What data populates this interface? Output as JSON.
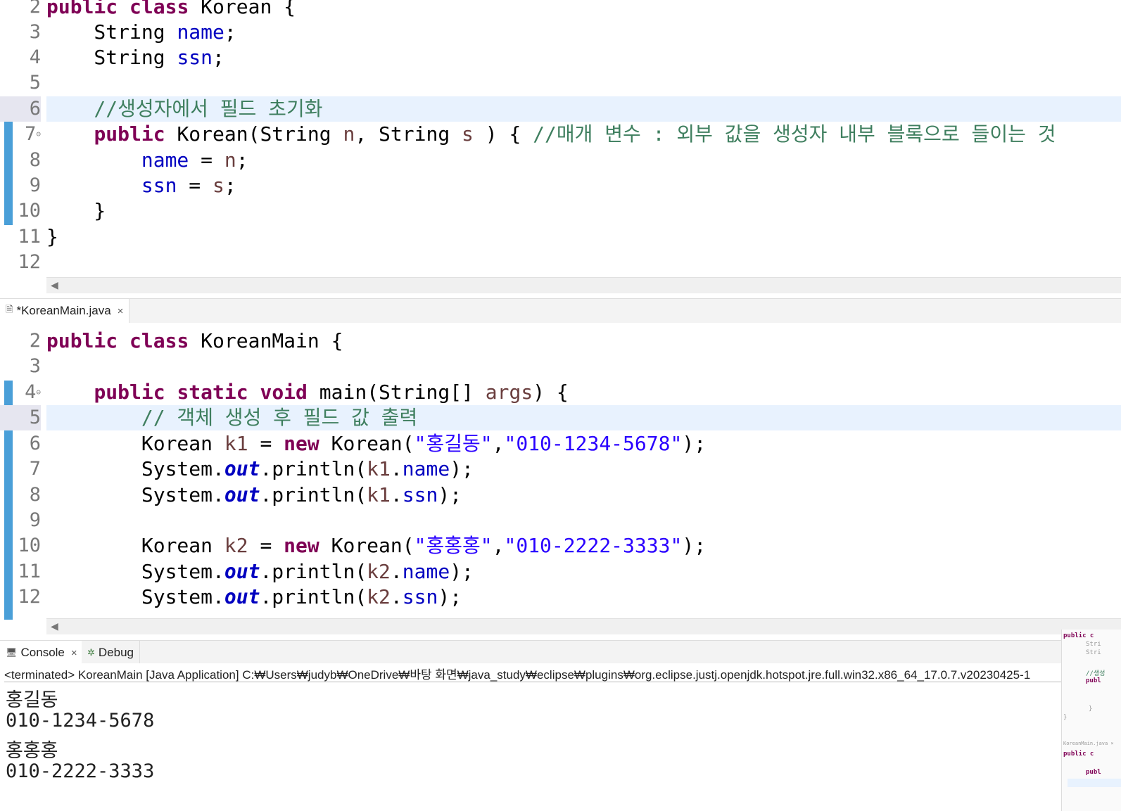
{
  "editor_top": {
    "lines": [
      {
        "no": "2",
        "segments": [
          [
            "kw",
            "public class"
          ],
          [
            "",
            "Korean {"
          ]
        ],
        "spaced": true
      },
      {
        "no": "3",
        "code": "    String name;"
      },
      {
        "no": "4",
        "code": "    String ssn;"
      },
      {
        "no": "5",
        "code": ""
      },
      {
        "no": "6",
        "code": "    //생성자에서 필드 초기화"
      },
      {
        "no": "7",
        "code": "    public Korean(String n, String s ) { //매개 변수 : 외부 값을 생성자 내부 블록으로 들이는 것"
      },
      {
        "no": "8",
        "code": "        name = n;"
      },
      {
        "no": "9",
        "code": "        ssn = s;"
      },
      {
        "no": "10",
        "code": "    }"
      },
      {
        "no": "11",
        "code": "}"
      },
      {
        "no": "12",
        "code": ""
      }
    ]
  },
  "editor_tab": {
    "title": "*KoreanMain.java",
    "close": "×"
  },
  "editor_main": {
    "lines": [
      {
        "no": "2",
        "code": "public class KoreanMain {"
      },
      {
        "no": "3",
        "code": ""
      },
      {
        "no": "4",
        "code": "    public static void main(String[] args) {"
      },
      {
        "no": "5",
        "code": "        // 객체 생성 후 필드 값 출력"
      },
      {
        "no": "6",
        "code": "        Korean k1 = new Korean(\"홍길동\",\"010-1234-5678\");"
      },
      {
        "no": "7",
        "code": "        System.out.println(k1.name);"
      },
      {
        "no": "8",
        "code": "        System.out.println(k1.ssn);"
      },
      {
        "no": "9",
        "code": ""
      },
      {
        "no": "10",
        "code": "        Korean k2 = new Korean(\"홍홍홍\",\"010-2222-3333\");"
      },
      {
        "no": "11",
        "code": "        System.out.println(k2.name);"
      },
      {
        "no": "12",
        "code": "        System.out.println(k2.ssn);"
      }
    ]
  },
  "console": {
    "tabs": [
      {
        "label": "Console",
        "close": "×"
      },
      {
        "label": "Debug"
      }
    ],
    "header": "<terminated> KoreanMain [Java Application] C:₩Users₩judyb₩OneDrive₩바탕 화면₩java_study₩eclipse₩plugins₩org.eclipse.justj.openjdk.hotspot.jre.full.win32.x86_64_17.0.7.v20230425-1",
    "output": [
      "홍길동",
      "010-1234-5678",
      "홍홍홍",
      "010-2222-3333"
    ]
  }
}
